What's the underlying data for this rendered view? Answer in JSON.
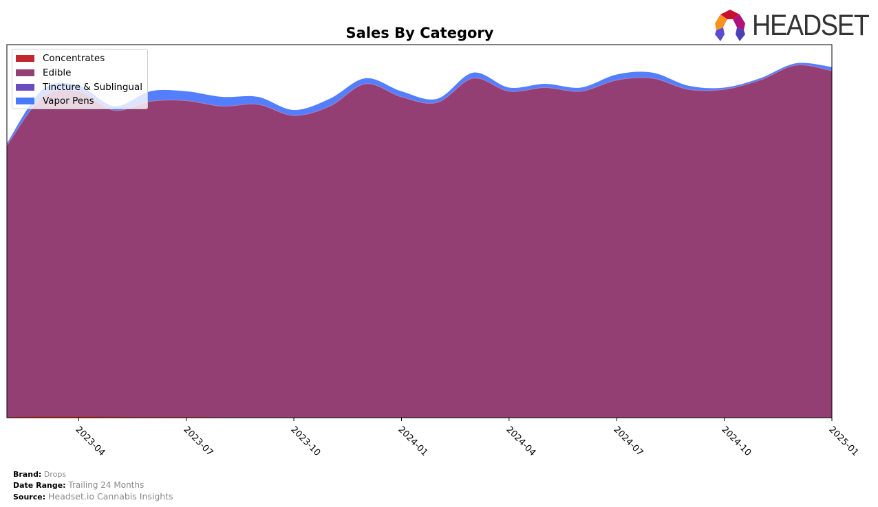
{
  "logo": {
    "text": "HEADSET"
  },
  "footer": {
    "brand_label": "Brand:",
    "brand_value": "Drops",
    "date_range_label": "Date Range:",
    "date_range_value": "Trailing 24 Months",
    "source_label": "Source:",
    "source_value": "Headset.io Cannabis Insights"
  },
  "chart_data": {
    "type": "area",
    "stacked": true,
    "title": "Sales By Category",
    "xlabel": "",
    "ylabel": "",
    "y_axis_visible": false,
    "grid": false,
    "legend_position": "top-left",
    "x": [
      "2023-02",
      "2023-03",
      "2023-04",
      "2023-05",
      "2023-06",
      "2023-07",
      "2023-08",
      "2023-09",
      "2023-10",
      "2023-11",
      "2023-12",
      "2024-01",
      "2024-02",
      "2024-03",
      "2024-04",
      "2024-05",
      "2024-06",
      "2024-07",
      "2024-08",
      "2024-09",
      "2024-10",
      "2024-11",
      "2024-12",
      "2025-01"
    ],
    "x_ticks": [
      "2023-04",
      "2023-07",
      "2023-10",
      "2024-01",
      "2024-04",
      "2024-07",
      "2024-10",
      "2025-01"
    ],
    "x_range": [
      "2023-02",
      "2025-01"
    ],
    "y_range": [
      0,
      100
    ],
    "y_units": "relative sales (estimated, plot top = 100)",
    "series": [
      {
        "name": "Concentrates",
        "color": "#c1272d",
        "values": [
          0.2,
          0.4,
          0.4,
          0.3,
          0.2,
          0.2,
          0.1,
          0.1,
          0.1,
          0.1,
          0.1,
          0.1,
          0.1,
          0.1,
          0.1,
          0.1,
          0.1,
          0.1,
          0.1,
          0.1,
          0.1,
          0.1,
          0.1,
          0.1
        ]
      },
      {
        "name": "Edible",
        "color": "#933f74",
        "values": [
          72.8,
          85.6,
          87.1,
          82.1,
          84.6,
          84.8,
          83.4,
          83.9,
          80.9,
          83.4,
          89.4,
          85.9,
          84.4,
          90.9,
          87.4,
          88.4,
          87.4,
          90.4,
          90.9,
          87.9,
          87.9,
          90.4,
          94.4,
          92.9
        ]
      },
      {
        "name": "Tincture & Sublingual",
        "color": "#6b4cbd",
        "values": [
          0,
          0,
          0,
          0,
          0,
          0,
          0,
          0,
          0,
          0,
          0,
          0,
          0,
          0,
          0,
          0,
          0,
          0,
          0,
          0,
          0,
          0,
          0,
          0
        ]
      },
      {
        "name": "Vapor Pens",
        "color": "#4a78ff",
        "values": [
          0.5,
          2.0,
          1.5,
          1.1,
          2.7,
          2.5,
          2.5,
          2.0,
          1.5,
          2.0,
          1.5,
          1.5,
          1.0,
          1.5,
          1.0,
          1.0,
          1.0,
          1.5,
          1.5,
          1.0,
          0.5,
          0.5,
          0.5,
          1.0
        ]
      }
    ]
  }
}
